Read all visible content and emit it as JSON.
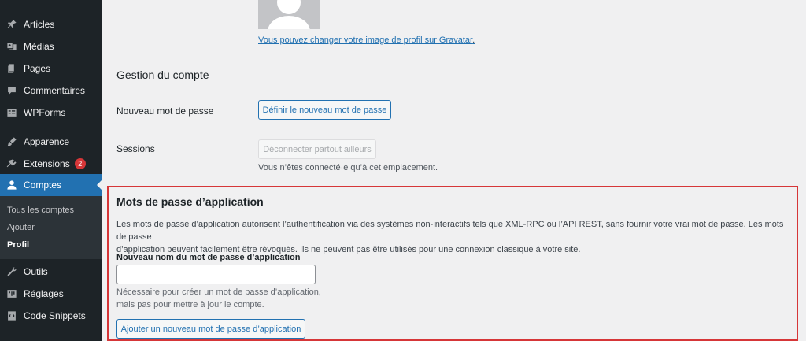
{
  "sidebar": {
    "items": [
      {
        "label": "Articles",
        "icon": "pin-icon"
      },
      {
        "label": "Médias",
        "icon": "media-icon"
      },
      {
        "label": "Pages",
        "icon": "pages-icon"
      },
      {
        "label": "Commentaires",
        "icon": "comments-icon"
      },
      {
        "label": "WPForms",
        "icon": "forms-icon"
      },
      {
        "label": "Apparence",
        "icon": "brush-icon"
      },
      {
        "label": "Extensions",
        "icon": "plugin-icon",
        "badge": "2"
      },
      {
        "label": "Comptes",
        "icon": "user-icon",
        "active": true
      },
      {
        "label": "Outils",
        "icon": "wrench-icon"
      },
      {
        "label": "Réglages",
        "icon": "settings-icon"
      },
      {
        "label": "Code Snippets",
        "icon": "snippets-icon"
      }
    ],
    "submenu": [
      {
        "label": "Tous les comptes"
      },
      {
        "label": "Ajouter"
      },
      {
        "label": "Profil",
        "current": true
      }
    ],
    "colors": {
      "background": "#1d2327",
      "active": "#2271b1",
      "badge": "#d63638"
    }
  },
  "profile": {
    "gravatar_link": "Vous pouvez changer votre image de profil sur Gravatar",
    "gravatar_link_suffix": "."
  },
  "account": {
    "title": "Gestion du compte",
    "new_password_label": "Nouveau mot de passe",
    "new_password_button": "Définir le nouveau mot de passe",
    "sessions_label": "Sessions",
    "sessions_button": "Déconnecter partout ailleurs",
    "sessions_desc": "Vous n’êtes connecté·e qu’à cet emplacement."
  },
  "app_passwords": {
    "title": "Mots de passe d’application",
    "desc_line1": "Les mots de passe d’application autorisent l’authentification via des systèmes non-interactifs tels que XML-RPC ou l’API REST, sans fournir votre vrai mot de passe. Les mots de passe",
    "desc_line2": "d’application peuvent facilement être révoqués. Ils ne peuvent pas être utilisés pour une connexion classique à votre site.",
    "field_label": "Nouveau nom du mot de passe d’application",
    "field_value": "",
    "help_line1": "Nécessaire pour créer un mot de passe d’application,",
    "help_line2": "mais pas pour mettre à jour le compte.",
    "add_button": "Ajouter un nouveau mot de passe d’application",
    "highlight_color": "#d63638"
  }
}
